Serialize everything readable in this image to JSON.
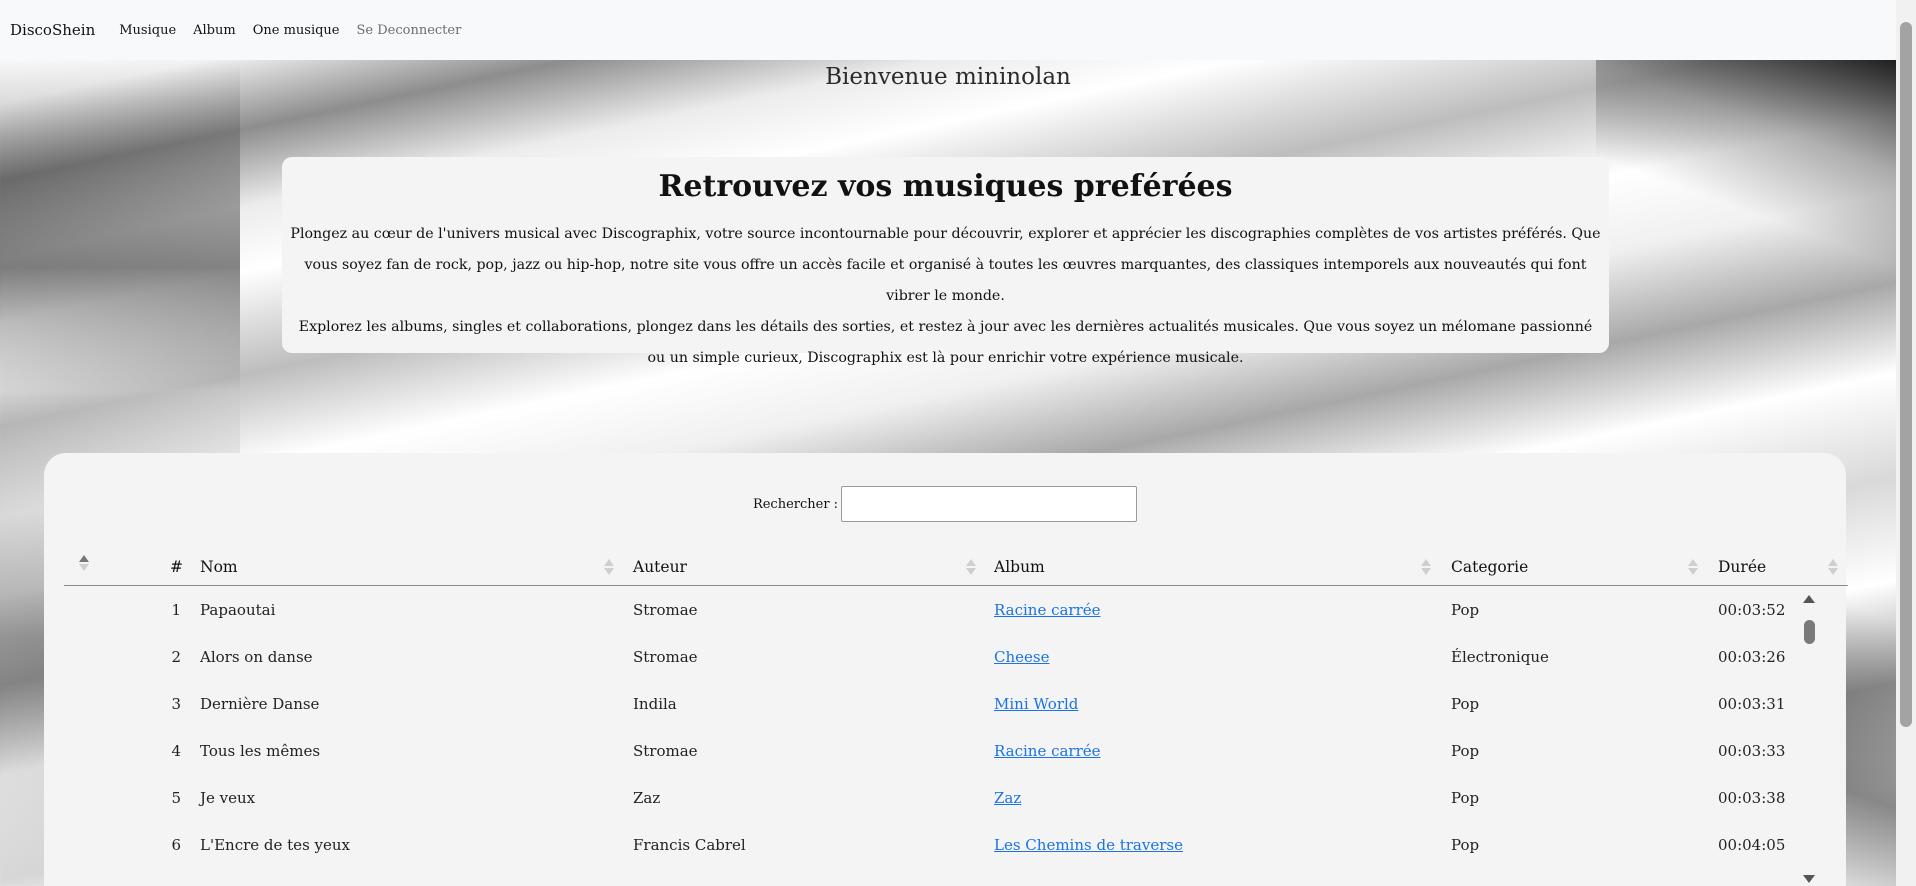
{
  "nav": {
    "brand": "DiscoShein",
    "links": [
      "Musique",
      "Album",
      "One musique",
      "Se Deconnecter"
    ]
  },
  "welcome": "Bienvenue mininolan",
  "intro": {
    "title": "Retrouvez vos musiques preférées",
    "paragraph1": "Plongez au cœur de l'univers musical avec Discographix, votre source incontournable pour découvrir, explorer et apprécier les discographies complètes de vos artistes préférés. Que vous soyez fan de rock, pop, jazz ou hip-hop, notre site vous offre un accès facile et organisé à toutes les œuvres marquantes, des classiques intemporels aux nouveautés qui font vibrer le monde.",
    "paragraph2": "Explorez les albums, singles et collaborations, plongez dans les détails des sorties, et restez à jour avec les dernières actualités musicales. Que vous soyez un mélomane passionné ou un simple curieux, Discographix est là pour enrichir votre expérience musicale."
  },
  "search": {
    "label": "Rechercher :",
    "value": ""
  },
  "table": {
    "columns": [
      "#",
      "Nom",
      "Auteur",
      "Album",
      "Categorie",
      "Durée"
    ],
    "rows": [
      {
        "num": "1",
        "nom": "Papaoutai",
        "auteur": "Stromae",
        "album": "Racine carrée",
        "categorie": "Pop",
        "duree": "00:03:52"
      },
      {
        "num": "2",
        "nom": "Alors on danse",
        "auteur": "Stromae",
        "album": "Cheese",
        "categorie": "Électronique",
        "duree": "00:03:26"
      },
      {
        "num": "3",
        "nom": "Dernière Danse",
        "auteur": "Indila",
        "album": "Mini World",
        "categorie": "Pop",
        "duree": "00:03:31"
      },
      {
        "num": "4",
        "nom": "Tous les mêmes",
        "auteur": "Stromae",
        "album": "Racine carrée",
        "categorie": "Pop",
        "duree": "00:03:33"
      },
      {
        "num": "5",
        "nom": "Je veux",
        "auteur": "Zaz",
        "album": "Zaz",
        "categorie": "Pop",
        "duree": "00:03:38"
      },
      {
        "num": "6",
        "nom": "L'Encre de tes yeux",
        "auteur": "Francis Cabrel",
        "album": "Les Chemins de traverse",
        "categorie": "Pop",
        "duree": "00:04:05"
      }
    ]
  },
  "colors": {
    "link": "#1a73e8",
    "navbar": "#f8f9fa",
    "card": "#f4f4f4"
  }
}
